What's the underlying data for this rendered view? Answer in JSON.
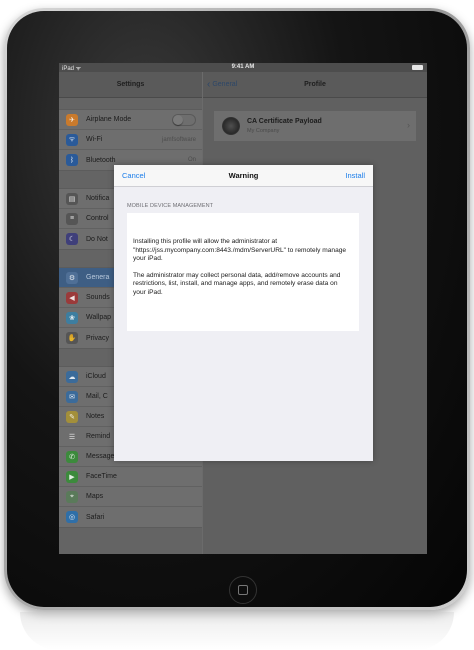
{
  "status_bar": {
    "carrier": "iPad ᯤ",
    "time": "9:41 AM"
  },
  "settings": {
    "title": "Settings",
    "groups": [
      {
        "items": [
          {
            "label": "Airplane Mode",
            "icon": "airplane-icon",
            "icon_color": "#c97a2c",
            "control": "toggle",
            "toggle_on": false
          },
          {
            "label": "Wi-Fi",
            "icon": "wifi-icon",
            "icon_color": "#2a5a99",
            "value": "jamfsoftware"
          },
          {
            "label": "Bluetooth",
            "icon": "bluetooth-icon",
            "icon_color": "#2a5a99",
            "value": "On"
          }
        ]
      },
      {
        "items": [
          {
            "label": "Notifica",
            "icon": "notifications-icon",
            "icon_color": "#555555"
          },
          {
            "label": "Control",
            "icon": "control-center-icon",
            "icon_color": "#555555"
          },
          {
            "label": "Do Not",
            "icon": "do-not-disturb-icon",
            "icon_color": "#3f3f7a"
          }
        ]
      },
      {
        "items": [
          {
            "label": "Genera",
            "icon": "gear-icon",
            "icon_color": "#4f6f96",
            "selected": true
          },
          {
            "label": "Sounds",
            "icon": "sounds-icon",
            "icon_color": "#9a3a3a"
          },
          {
            "label": "Wallpap",
            "icon": "wallpaper-icon",
            "icon_color": "#3d7ea0"
          },
          {
            "label": "Privacy",
            "icon": "privacy-icon",
            "icon_color": "#555555"
          }
        ]
      },
      {
        "items": [
          {
            "label": "iCloud",
            "icon": "icloud-icon",
            "icon_color": "#3b6b9a"
          },
          {
            "label": "Mail, C",
            "icon": "mail-icon",
            "icon_color": "#3b6b9a"
          },
          {
            "label": "Notes",
            "icon": "notes-icon",
            "icon_color": "#a38f3a"
          },
          {
            "label": "Remind",
            "icon": "reminders-icon",
            "icon_color": "#6e6e6e"
          },
          {
            "label": "Messages",
            "icon": "messages-icon",
            "icon_color": "#3c8a3c"
          },
          {
            "label": "FaceTime",
            "icon": "facetime-icon",
            "icon_color": "#3c8a3c"
          },
          {
            "label": "Maps",
            "icon": "maps-icon",
            "icon_color": "#5a7a5a"
          },
          {
            "label": "Safari",
            "icon": "safari-icon",
            "icon_color": "#2f6fa8"
          }
        ]
      }
    ]
  },
  "profile": {
    "back_label": "General",
    "title": "Profile",
    "payload_name": "CA Certificate Payload",
    "company": "My Company"
  },
  "modal": {
    "cancel_label": "Cancel",
    "title": "Warning",
    "install_label": "Install",
    "section_label": "MOBILE DEVICE MANAGEMENT",
    "paragraph_1": "Installing this profile will allow the administrator at \"https://jss.mycompany.com:8443./mdm/ServerURL\" to remotely manage your iPad.",
    "paragraph_2": "The administrator may collect personal data, add/remove accounts and restrictions, list, install, and manage apps, and remotely erase data on your iPad."
  },
  "colors": {
    "ios_blue": "#1a7dea",
    "selected_row": "#3e5e84",
    "device_bezel": "#141414"
  }
}
